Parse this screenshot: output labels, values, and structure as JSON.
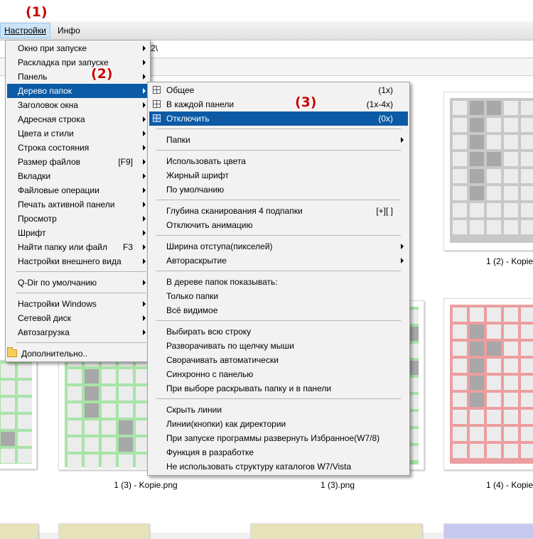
{
  "menubar": {
    "settings": "Настройки",
    "info": "Инфо"
  },
  "address": {
    "text": "2\\"
  },
  "annotations": {
    "a1": "(1)",
    "a2": "(2)",
    "a3": "(3)"
  },
  "settings_menu": {
    "items": [
      {
        "label": "Окно при запуске",
        "arrow": true
      },
      {
        "label": "Раскладка при запуске",
        "arrow": true
      },
      {
        "label": "Панель",
        "arrow": true
      },
      {
        "label": "Дерево папок",
        "arrow": true,
        "highlight": true
      },
      {
        "label": "Заголовок окна",
        "arrow": true
      },
      {
        "label": "Адресная строка",
        "arrow": true
      },
      {
        "label": "Цвета и стили",
        "arrow": true
      },
      {
        "label": "Строка состояния",
        "arrow": true
      },
      {
        "label": "Размер файлов",
        "shortcut": "[F9]",
        "arrow": true
      },
      {
        "label": "Вкладки",
        "arrow": true
      },
      {
        "label": "Файловые операции",
        "arrow": true
      },
      {
        "label": "Печать активной панели",
        "arrow": true
      },
      {
        "label": "Просмотр",
        "arrow": true
      },
      {
        "label": "Шрифт",
        "arrow": true
      },
      {
        "label": "Найти папку или файл",
        "shortcut": "F3",
        "arrow": true
      },
      {
        "label": "Настройки внешнего вида",
        "arrow": true
      },
      {
        "label": "Q-Dir по умолчанию",
        "arrow": true
      },
      {
        "label": "Настройки Windows",
        "arrow": true
      },
      {
        "label": "Сетевой диск",
        "arrow": true
      },
      {
        "label": "Автозагрузка",
        "arrow": true
      },
      {
        "label": "Дополнительно..",
        "icon": "folder-icon"
      }
    ]
  },
  "tree_menu": {
    "items": [
      {
        "label": "Общее",
        "shortcut": "(1x)",
        "icon": "tree-icon"
      },
      {
        "label": "В каждой панели",
        "shortcut": "(1x-4x)",
        "icon": "tree-icon"
      },
      {
        "label": "Отключить",
        "shortcut": "(0x)",
        "icon": "tree-icon",
        "highlight": true
      },
      {
        "label": "Папки",
        "arrow": true
      },
      {
        "label": "Использовать цвета"
      },
      {
        "label": "Жирный шрифт"
      },
      {
        "label": "По умолчанию"
      },
      {
        "label": "Глубина сканирования 4 подпапки",
        "shortcut": "[+][ ]"
      },
      {
        "label": "Отключить анимацию"
      },
      {
        "label": "Ширина отступа(пикселей)",
        "arrow": true
      },
      {
        "label": "Автораскрытие",
        "arrow": true
      },
      {
        "label": "В дереве папок показывать:"
      },
      {
        "label": "Только папки"
      },
      {
        "label": "Всё видимое"
      },
      {
        "label": "Выбирать всю строку"
      },
      {
        "label": "Разворачивать по щелчку мыши"
      },
      {
        "label": "Сворачивать автоматически"
      },
      {
        "label": "Синхронно с панелью"
      },
      {
        "label": "При выборе раскрывать папку и в панели"
      },
      {
        "label": "Скрыть линии"
      },
      {
        "label": "Линии(кнопки) как директории"
      },
      {
        "label": "При запуске программы развернуть Избранное(W7/8)"
      },
      {
        "label": "Функция в разработке"
      },
      {
        "label": "Не использовать структуру каталогов W7/Vista"
      }
    ]
  },
  "thumbnails": [
    {
      "label": "1 (2) - Kopie",
      "color": "#c8c8c8"
    },
    {
      "label": "1 (3) - Kopie.png",
      "color": "#a8e4a8"
    },
    {
      "label": "1 (3).png",
      "color": "#a8e4a8"
    },
    {
      "label": "1 (4) - Kopie",
      "color": "#ec9ea0"
    }
  ]
}
